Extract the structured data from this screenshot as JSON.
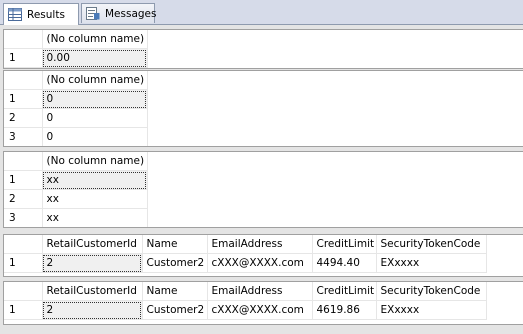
{
  "tabs": [
    {
      "label": "Results",
      "icon": "grid-icon"
    },
    {
      "label": "Messages",
      "icon": "messages-icon"
    }
  ],
  "grids": [
    {
      "columns": [
        "(No column name)"
      ],
      "rows": [
        [
          "1",
          "0.00"
        ]
      ]
    },
    {
      "columns": [
        "(No column name)"
      ],
      "rows": [
        [
          "1",
          "0"
        ],
        [
          "2",
          "0"
        ],
        [
          "3",
          "0"
        ]
      ]
    },
    {
      "columns": [
        "(No column name)"
      ],
      "rows": [
        [
          "1",
          "xx"
        ],
        [
          "2",
          "xx"
        ],
        [
          "3",
          "xx"
        ]
      ]
    },
    {
      "columns": [
        "RetailCustomerId",
        "Name",
        "EmailAddress",
        "CreditLimit",
        "SecurityTokenCode"
      ],
      "rows": [
        [
          "1",
          "2",
          "Customer2",
          "cXXX@XXXX.com",
          "4494.40",
          "EXxxxx"
        ]
      ]
    },
    {
      "columns": [
        "RetailCustomerId",
        "Name",
        "EmailAddress",
        "CreditLimit",
        "SecurityTokenCode"
      ],
      "rows": [
        [
          "1",
          "2",
          "Customer2",
          "cXXX@XXXX.com",
          "4619.86",
          "EXxxxx"
        ]
      ]
    }
  ]
}
